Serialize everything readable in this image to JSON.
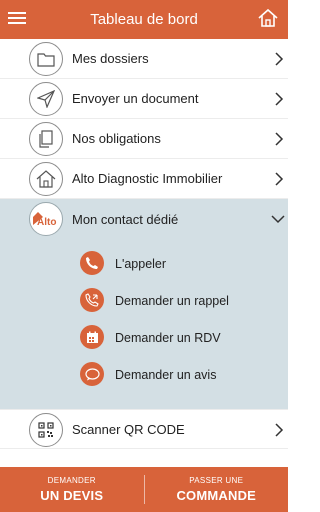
{
  "header": {
    "title": "Tableau de bord",
    "menu_icon": "hamburger-icon",
    "home_icon": "home-icon"
  },
  "menu": {
    "items": [
      {
        "label": "Mes dossiers",
        "icon": "folder-icon"
      },
      {
        "label": "Envoyer un document",
        "icon": "send-icon"
      },
      {
        "label": "Nos obligations",
        "icon": "documents-icon"
      },
      {
        "label": "Alto Diagnostic Immobilier",
        "icon": "house-icon"
      },
      {
        "label": "Mon contact dédié",
        "icon": "alto-logo"
      },
      {
        "label": "Scanner QR CODE",
        "icon": "qr-code-icon"
      }
    ],
    "contact_sub": [
      {
        "label": "L'appeler",
        "icon": "phone-icon"
      },
      {
        "label": "Demander un rappel",
        "icon": "phone-callback-icon"
      },
      {
        "label": "Demander un RDV",
        "icon": "calendar-icon"
      },
      {
        "label": "Demander un avis",
        "icon": "chat-icon"
      }
    ],
    "logo_text": "Alto"
  },
  "footer": {
    "left_small": "DEMANDER",
    "left_big": "UN DEVIS",
    "right_small": "PASSER UNE",
    "right_big": "COMMANDE"
  },
  "colors": {
    "accent": "#d8633a",
    "expanded_bg": "#d3dfe4"
  }
}
